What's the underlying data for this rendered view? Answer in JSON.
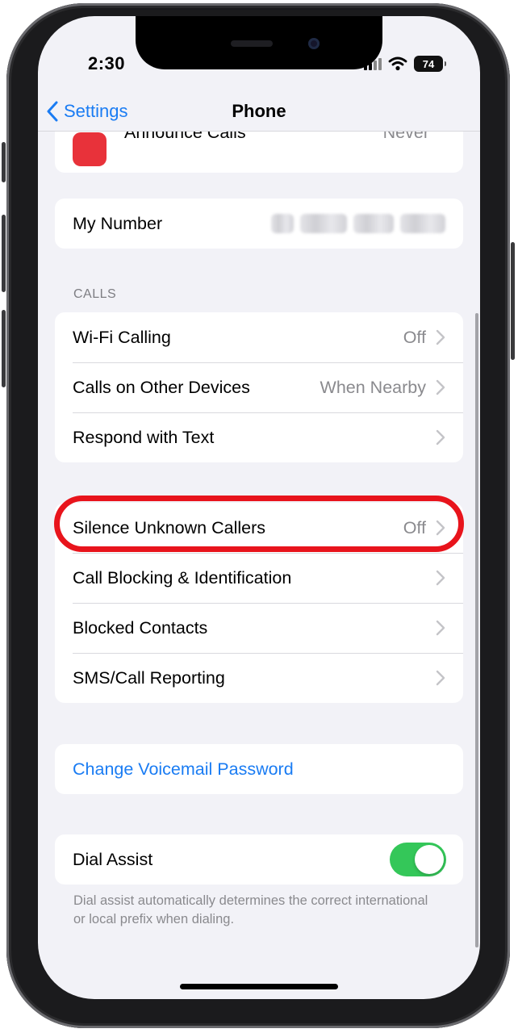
{
  "status_bar": {
    "time": "2:30",
    "battery_percent": "74"
  },
  "nav": {
    "back_label": "Settings",
    "title": "Phone"
  },
  "partial_row": {
    "label": "Announce Calls",
    "value": "Never"
  },
  "my_number": {
    "label": "My Number"
  },
  "calls_section": {
    "header": "CALLS",
    "rows": [
      {
        "label": "Wi-Fi Calling",
        "value": "Off"
      },
      {
        "label": "Calls on Other Devices",
        "value": "When Nearby"
      },
      {
        "label": "Respond with Text",
        "value": ""
      }
    ]
  },
  "blocking_section": {
    "rows": [
      {
        "label": "Silence Unknown Callers",
        "value": "Off"
      },
      {
        "label": "Call Blocking & Identification",
        "value": ""
      },
      {
        "label": "Blocked Contacts",
        "value": ""
      },
      {
        "label": "SMS/Call Reporting",
        "value": ""
      }
    ]
  },
  "voicemail": {
    "label": "Change Voicemail Password"
  },
  "dial_assist": {
    "label": "Dial Assist",
    "enabled": true,
    "footnote": "Dial assist automatically determines the correct international or local prefix when dialing."
  },
  "colors": {
    "accent": "#1a7cf3",
    "toggle_on": "#34c759",
    "highlight": "#e8141c",
    "background": "#f2f2f7"
  }
}
